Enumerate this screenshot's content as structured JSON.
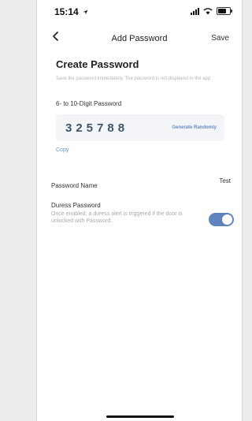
{
  "status": {
    "time": "15:14"
  },
  "nav": {
    "title": "Add Password",
    "save_label": "Save"
  },
  "create": {
    "heading": "Create Password",
    "note": "Save the password immediately. The password is not displayed in the app.",
    "digits_label": "6- to 10-Digit Password",
    "password": "325788",
    "generate_label": "Generate Randomly",
    "copy_label": "Copy"
  },
  "password_name": {
    "label": "Password Name",
    "value": "Test"
  },
  "duress": {
    "title": "Duress Password",
    "description": "Once enabled, a duress alert is triggered if the door is unlocked with Password.",
    "enabled": true
  },
  "icons": [
    "back-icon",
    "signal-icon",
    "wifi-icon",
    "battery-icon",
    "location-arrow-icon"
  ],
  "colors": {
    "accent": "#5f83bf",
    "link": "#6d93d1",
    "password_box": "#f3f5f8"
  }
}
